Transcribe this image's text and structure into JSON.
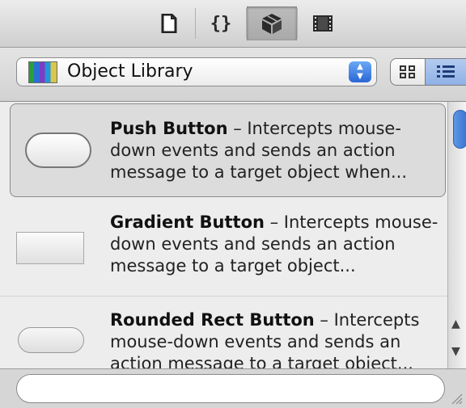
{
  "toolbar": {
    "tabs": [
      {
        "icon": "file-inspector-icon"
      },
      {
        "icon": "quick-help-icon",
        "glyph": "{}"
      },
      {
        "icon": "object-library-icon"
      },
      {
        "icon": "media-library-icon"
      }
    ],
    "active_tab": 2
  },
  "library": {
    "selected": "Object Library",
    "view_mode": "list"
  },
  "items": [
    {
      "name": "Push Button",
      "description": " – Intercepts mouse-down events and sends an action message to a target object when...",
      "selected": true
    },
    {
      "name": "Gradient Button",
      "description": " – Intercepts mouse-down events and sends an action message to a target object...",
      "selected": false
    },
    {
      "name": "Rounded Rect Button",
      "description": " – Intercepts mouse-down events and sends an action message to a target object...",
      "selected": false
    }
  ],
  "search": {
    "value": "",
    "placeholder": ""
  }
}
